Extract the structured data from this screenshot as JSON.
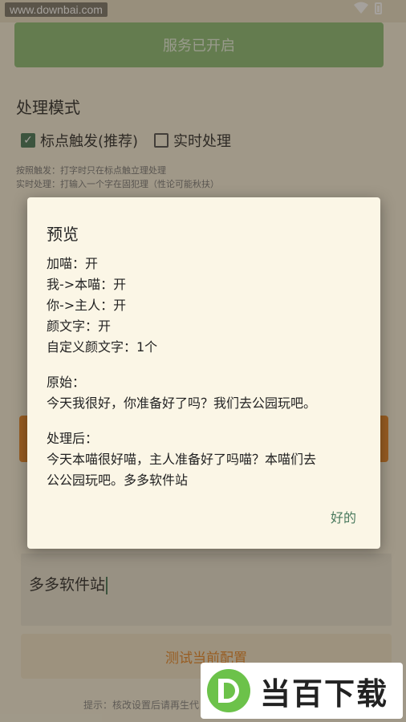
{
  "status_bar": {
    "watermark": "www.downbai.com"
  },
  "app": {
    "service_button": "服务已开启",
    "section_title": "处理模式",
    "mode_options": [
      {
        "label": "标点触发(推荐)",
        "checked": true
      },
      {
        "label": "实时处理",
        "checked": false
      }
    ],
    "hint_punctuation": "按照触发：打字时只在标点触立理处理",
    "hint_realtime": "实时处理：打输入一个字在固犯理（性论可能秋扶）",
    "input_text": "多多软件站",
    "test_button": "测试当前配置",
    "footer_hint": "提示：核改设置后请再生代"
  },
  "dialog": {
    "title": "预览",
    "settings": [
      "加喵：开",
      "我->本喵：开",
      "你->主人：开",
      "颜文字：开",
      "自定义颜文字：1个"
    ],
    "original_label": "原始：",
    "original_text": "今天我很好，你准备好了吗？我们去公园玩吧。",
    "processed_label": "处理后：",
    "processed_line1": "今天本喵很好喵，主人准备好了吗喵？本喵们去",
    "processed_line2": "公公园玩吧。多多软件站",
    "ok_button": "好的"
  },
  "watermark_logo": {
    "text": "当百下载"
  },
  "colors": {
    "accent_green": "#4a7a5e",
    "service_green": "#8fbf7a",
    "orange": "#e88a2e",
    "dialog_bg": "#fbf6e6"
  }
}
